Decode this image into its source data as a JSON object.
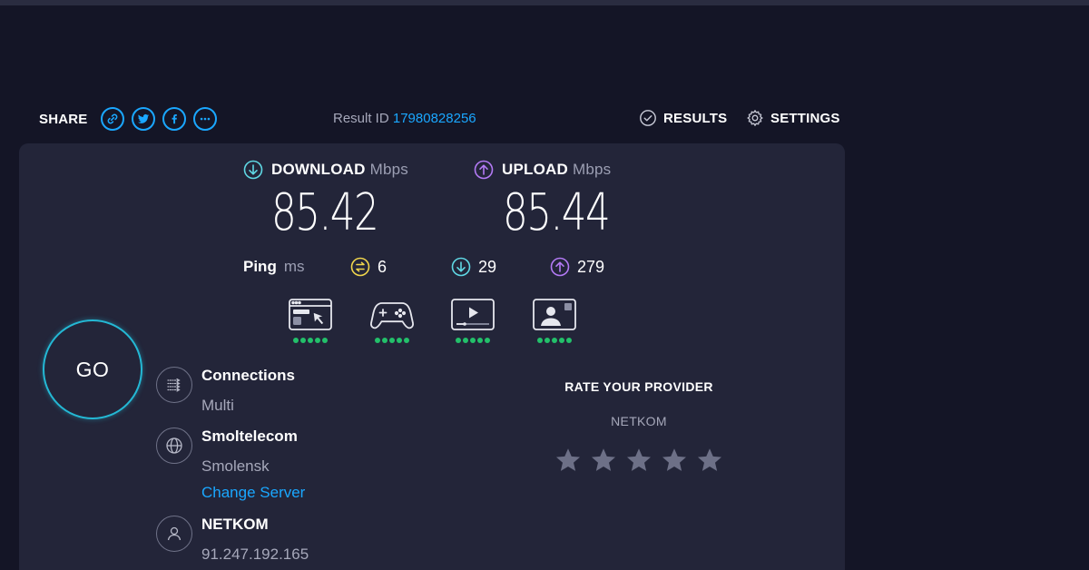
{
  "header": {
    "share_label": "SHARE",
    "share_buttons": [
      "link-icon",
      "twitter-icon",
      "facebook-icon",
      "more-icon"
    ],
    "result_id_label": "Result ID",
    "result_id": "17980828256",
    "results_label": "RESULTS",
    "settings_label": "SETTINGS"
  },
  "download": {
    "label": "DOWNLOAD",
    "unit": "Mbps",
    "value": "85.42"
  },
  "upload": {
    "label": "UPLOAD",
    "unit": "Mbps",
    "value": "85.44"
  },
  "ping": {
    "label": "Ping",
    "unit": "ms",
    "idle": "6",
    "download": "29",
    "upload": "279"
  },
  "quality": [
    {
      "icon": "web-browsing-icon",
      "level": 5,
      "max": 5
    },
    {
      "icon": "gaming-icon",
      "level": 5,
      "max": 5
    },
    {
      "icon": "video-streaming-icon",
      "level": 5,
      "max": 5
    },
    {
      "icon": "video-call-icon",
      "level": 5,
      "max": 5
    }
  ],
  "go_label": "GO",
  "connections": {
    "title": "Connections",
    "value": "Multi"
  },
  "server": {
    "title": "Smoltelecom",
    "location": "Smolensk",
    "change_label": "Change Server"
  },
  "isp": {
    "title": "NETKOM",
    "ip": "91.247.192.165"
  },
  "rate": {
    "title": "RATE YOUR PROVIDER",
    "provider": "NETKOM",
    "stars": 5,
    "rating": 0
  },
  "colors": {
    "accent": "#1aa7ff",
    "download": "#5fd8e4",
    "upload": "#b37af5",
    "idle": "#f1d64c",
    "good": "#23c06a",
    "background": "#141526",
    "panel": "#232539"
  }
}
